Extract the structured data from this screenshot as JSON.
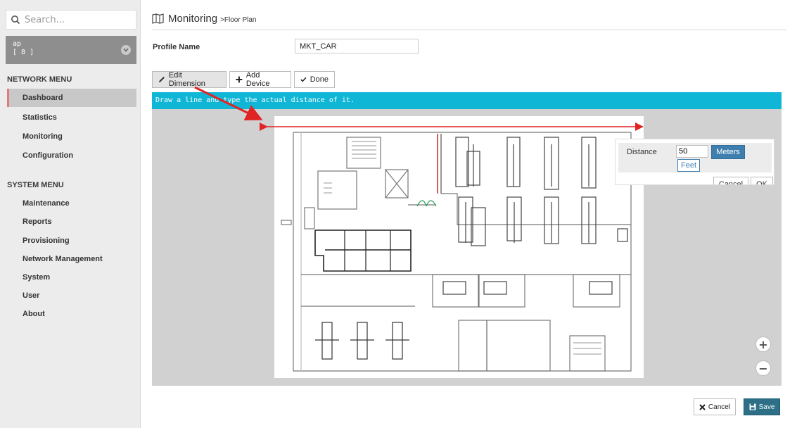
{
  "search": {
    "placeholder": "Search..."
  },
  "device_selector": {
    "line1": "ap",
    "line2": "[ 8 ]"
  },
  "network_menu": {
    "heading": "NETWORK MENU",
    "items": [
      {
        "label": "Dashboard",
        "active": true
      },
      {
        "label": "Statistics"
      },
      {
        "label": "Monitoring"
      },
      {
        "label": "Configuration"
      }
    ]
  },
  "system_menu": {
    "heading": "SYSTEM MENU",
    "items": [
      {
        "label": "Maintenance"
      },
      {
        "label": "Reports"
      },
      {
        "label": "Provisioning"
      },
      {
        "label": "Network Management"
      },
      {
        "label": "System"
      },
      {
        "label": "User"
      },
      {
        "label": "About"
      }
    ]
  },
  "page": {
    "title": "Monitoring",
    "breadcrumb": ">Floor Plan"
  },
  "profile": {
    "label": "Profile Name",
    "value": "MKT_CAR"
  },
  "toolbar": {
    "edit_dimension": "Edit Dimension",
    "add_device": "Add Device",
    "done": "Done"
  },
  "banner": {
    "text": "Draw a line and type the actual distance of it."
  },
  "distance_popup": {
    "label": "Distance",
    "value": "50",
    "meters": "Meters",
    "feet": "Feet",
    "cancel": "Cancel",
    "ok": "OK"
  },
  "zoom": {
    "in": "+",
    "out": "−"
  },
  "footer": {
    "cancel": "Cancel",
    "save": "Save"
  },
  "colors": {
    "accent_cyan": "#0fb6d6",
    "arrow_red": "#e02424",
    "save_teal": "#2c6f86",
    "meters_blue": "#3f7fb0",
    "active_marker": "#e27a7a"
  }
}
